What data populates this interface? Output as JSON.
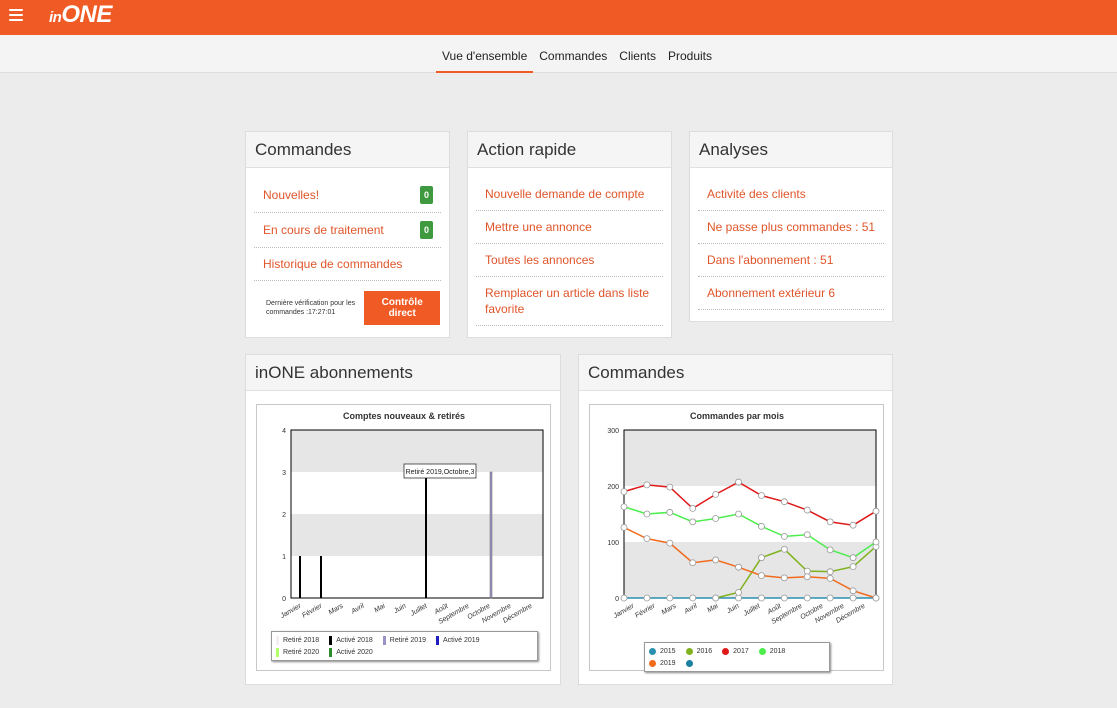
{
  "app": {
    "logo": "in",
    "logo_main": "ONE"
  },
  "nav": {
    "tabs": [
      {
        "label": "Vue d'ensemble",
        "active": true
      },
      {
        "label": "Commandes",
        "active": false
      },
      {
        "label": "Clients",
        "active": false
      },
      {
        "label": "Produits",
        "active": false
      }
    ]
  },
  "orders_panel": {
    "title": "Commandes",
    "items": [
      {
        "label": "Nouvelles!",
        "badge": "0"
      },
      {
        "label": "En cours de traitement",
        "badge": "0"
      },
      {
        "label": "Historique de commandes"
      }
    ],
    "last_check": "Dernière vérification pour les commandes :17:27:01",
    "button": "Contrôle direct"
  },
  "quick_panel": {
    "title": "Action rapide",
    "items": [
      {
        "label": "Nouvelle demande de compte"
      },
      {
        "label": "Mettre une annonce"
      },
      {
        "label": "Toutes les annonces"
      },
      {
        "label": "Remplacer un article dans liste favorite"
      }
    ]
  },
  "analysis_panel": {
    "title": "Analyses",
    "items": [
      {
        "label": "Activité des clients"
      },
      {
        "label": "Ne passe plus commandes : 51"
      },
      {
        "label": "Dans l'abonnement : 51"
      },
      {
        "label": "Abonnement extérieur 6"
      }
    ]
  },
  "subs_panel": {
    "title": "inONE abonnements"
  },
  "orders_chart_panel": {
    "title": "Commandes"
  },
  "chart_data": [
    {
      "type": "bar",
      "title": "Comptes nouveaux & retirés",
      "categories": [
        "Janvier",
        "Février",
        "Mars",
        "Avril",
        "Mai",
        "Juin",
        "Juillet",
        "Août",
        "Septembre",
        "Octobre",
        "Novembre",
        "Décembre"
      ],
      "ylim": [
        0,
        4
      ],
      "yticks": [
        0,
        1,
        2,
        3,
        4
      ],
      "grid": "alternating bands",
      "legend_position": "bottom",
      "series": [
        {
          "name": "Retiré 2018",
          "color": "#f4eef4",
          "values": [
            0,
            0,
            0,
            0,
            0,
            0,
            0,
            0,
            0,
            0,
            0,
            0
          ]
        },
        {
          "name": "Activé 2018",
          "color": "#000000",
          "values": [
            1,
            1,
            0,
            0,
            0,
            0,
            3,
            0,
            0,
            0,
            0,
            0
          ]
        },
        {
          "name": "Retiré 2019",
          "color": "#9a93c8",
          "values": [
            0,
            0,
            0,
            0,
            0,
            0,
            0,
            0,
            0,
            3,
            0,
            0
          ]
        },
        {
          "name": "Activé 2019",
          "color": "#1f1fbf",
          "values": [
            0,
            0,
            0,
            0,
            0,
            0,
            0,
            0,
            0,
            0,
            0,
            0
          ]
        },
        {
          "name": "Retiré 2020",
          "color": "#b3ff66",
          "values": [
            0,
            0,
            0,
            0,
            0,
            0,
            0,
            0,
            0,
            0,
            0,
            0
          ]
        },
        {
          "name": "Activé 2020",
          "color": "#2e8b2e",
          "values": [
            0,
            0,
            0,
            0,
            0,
            0,
            0,
            0,
            0,
            0,
            0,
            0
          ]
        }
      ],
      "tooltip": "Retiré 2019,Octobre,3"
    },
    {
      "type": "line",
      "title": "Commandes par mois",
      "categories": [
        "Janvier",
        "Février",
        "Mars",
        "Avril",
        "Mai",
        "Juin",
        "Juillet",
        "Août",
        "Septembre",
        "Octobre",
        "Novembre",
        "Décembre"
      ],
      "ylim": [
        0,
        300
      ],
      "yticks": [
        0,
        100,
        200,
        300
      ],
      "grid": "alternating bands",
      "legend_position": "bottom",
      "series": [
        {
          "name": "2015",
          "color": "#2b8fb0",
          "values": [
            0,
            0,
            0,
            0,
            0,
            0,
            0,
            0,
            0,
            0,
            0,
            0
          ]
        },
        {
          "name": "2016",
          "color": "#7fb21c",
          "values": [
            null,
            null,
            null,
            null,
            0,
            10,
            72,
            87,
            48,
            47,
            56,
            92
          ]
        },
        {
          "name": "2017",
          "color": "#e01818",
          "values": [
            190,
            202,
            198,
            160,
            185,
            207,
            183,
            172,
            157,
            136,
            130,
            155
          ]
        },
        {
          "name": "2018",
          "color": "#4ced4c",
          "values": [
            163,
            150,
            153,
            136,
            142,
            150,
            128,
            110,
            113,
            86,
            72,
            100
          ]
        },
        {
          "name": "2019",
          "color": "#f26b1d",
          "values": [
            126,
            106,
            98,
            63,
            68,
            55,
            40,
            36,
            38,
            35,
            13,
            0
          ]
        },
        {
          "name": "",
          "color": "#1a7fa0",
          "values": []
        }
      ]
    }
  ]
}
